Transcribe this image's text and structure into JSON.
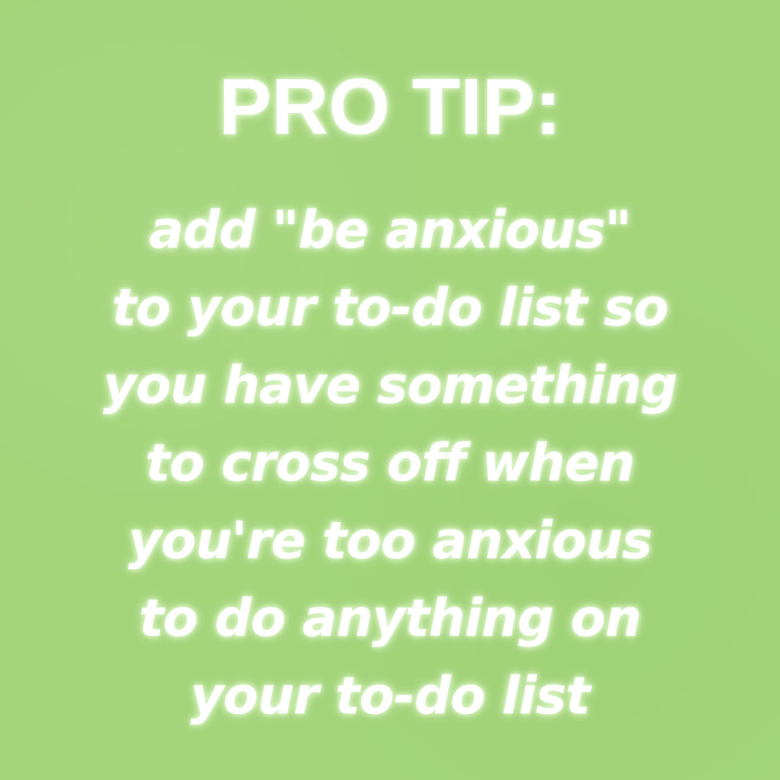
{
  "meme": {
    "title": "PRO TIP:",
    "lines": [
      "add \"be anxious\"",
      "to your to-do list so",
      "you have something",
      "to cross off when",
      "you're too anxious",
      "to do anything on",
      "your to-do list"
    ]
  },
  "colors": {
    "background": "#a3d47a",
    "text": "#ffffff",
    "glow": "#d6f0c0"
  }
}
